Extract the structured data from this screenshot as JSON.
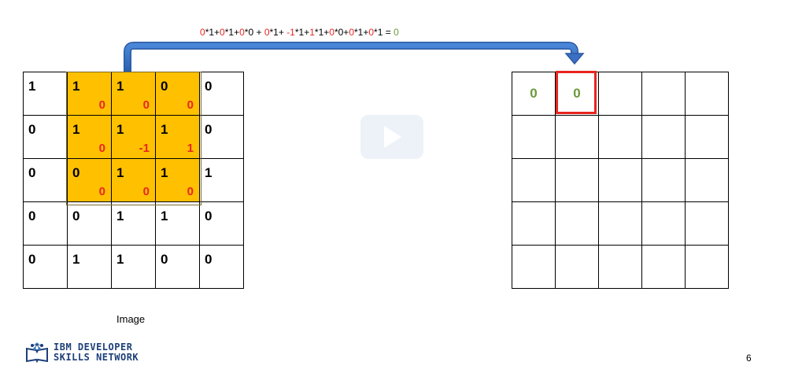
{
  "formula": {
    "parts": [
      {
        "t": "0",
        "c": "r"
      },
      {
        "t": "*1+",
        "c": ""
      },
      {
        "t": "0",
        "c": "r"
      },
      {
        "t": "*1+",
        "c": ""
      },
      {
        "t": "0",
        "c": "r"
      },
      {
        "t": "*0 + ",
        "c": ""
      },
      {
        "t": "0",
        "c": "r"
      },
      {
        "t": "*1+ ",
        "c": ""
      },
      {
        "t": "-1",
        "c": "r"
      },
      {
        "t": "*1+",
        "c": ""
      },
      {
        "t": "1",
        "c": "r"
      },
      {
        "t": "*1+",
        "c": ""
      },
      {
        "t": "0",
        "c": "r"
      },
      {
        "t": "*0+",
        "c": ""
      },
      {
        "t": "0",
        "c": "r"
      },
      {
        "t": "*1+",
        "c": ""
      },
      {
        "t": "0",
        "c": "r"
      },
      {
        "t": "*1 = ",
        "c": ""
      },
      {
        "t": "0",
        "c": "g"
      }
    ]
  },
  "image": {
    "caption": "Image",
    "rows": [
      [
        "1",
        "1",
        "1",
        "0",
        "0"
      ],
      [
        "0",
        "1",
        "1",
        "1",
        "0"
      ],
      [
        "0",
        "0",
        "1",
        "1",
        "1"
      ],
      [
        "0",
        "0",
        "1",
        "1",
        "0"
      ],
      [
        "0",
        "1",
        "1",
        "0",
        "0"
      ]
    ]
  },
  "kernel": {
    "row_offset": 0,
    "col_offset": 1,
    "weights": [
      [
        "0",
        "0",
        "0"
      ],
      [
        "0",
        "-1",
        "1"
      ],
      [
        "0",
        "0",
        "0"
      ]
    ]
  },
  "output": {
    "rows": [
      [
        "0",
        "0",
        "",
        "",
        ""
      ],
      [
        "",
        "",
        "",
        "",
        ""
      ],
      [
        "",
        "",
        "",
        "",
        ""
      ],
      [
        "",
        "",
        "",
        "",
        ""
      ],
      [
        "",
        "",
        "",
        "",
        ""
      ]
    ],
    "highlight": [
      0,
      1
    ]
  },
  "logo": {
    "line1": "IBM DEVELOPER",
    "line2": "SKILLS NETWORK"
  },
  "page_number": "6",
  "colors": {
    "kernel_fill": "#ffc000",
    "kernel_weight": "#e8251f",
    "output_value": "#6a9a3a",
    "arrow": "#3a6fc4",
    "highlight": "#e8251f"
  }
}
